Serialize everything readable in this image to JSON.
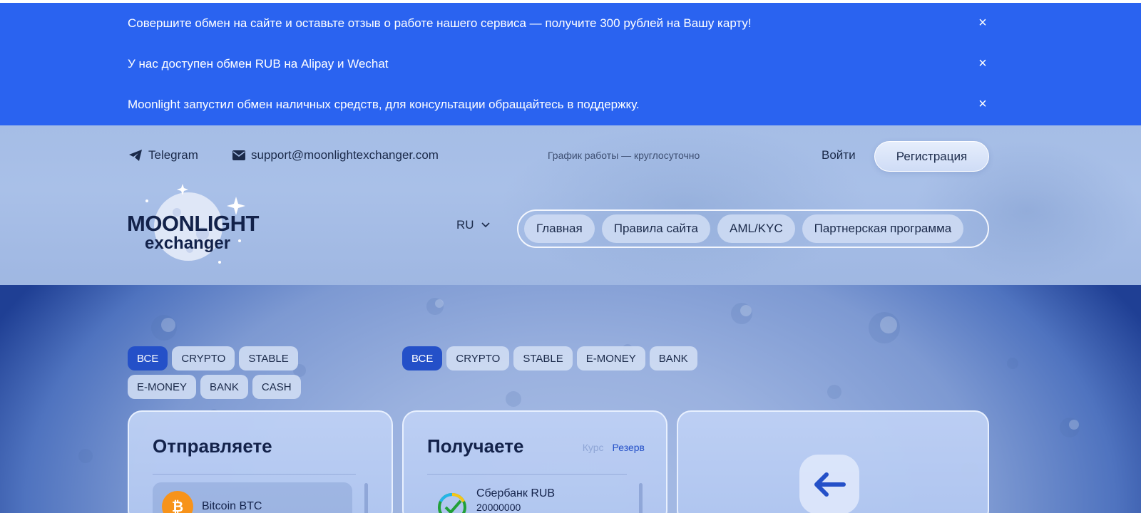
{
  "notices": [
    {
      "text": "Совершите обмен на сайте и оставьте отзыв о работе нашего сервиса — получите 300 рублей на Вашу карту!",
      "close": "×"
    },
    {
      "text": "У нас доступен обмен RUB на Alipay и Wechat",
      "close": "×"
    },
    {
      "text": "Moonlight запустил обмен наличных средств, для консультации обращайтесь в поддержку.",
      "close": "×"
    }
  ],
  "header": {
    "telegram": "Telegram",
    "email": "support@moonlightexchanger.com",
    "schedule": "График работы — круглосуточно",
    "login": "Войти",
    "register": "Регистрация"
  },
  "logo": {
    "line1": "MOONLIGHT",
    "line2": "exchanger"
  },
  "lang": {
    "current": "RU"
  },
  "nav": [
    "Главная",
    "Правила сайта",
    "AML/KYC",
    "Партнерская программа"
  ],
  "send_filters": [
    "ВСЕ",
    "CRYPTO",
    "STABLE",
    "E-MONEY",
    "BANK",
    "CASH"
  ],
  "receive_filters": [
    "ВСЕ",
    "CRYPTO",
    "STABLE",
    "E-MONEY",
    "BANK"
  ],
  "send": {
    "title": "Отправляете",
    "items": [
      {
        "name": "Bitcoin BTC",
        "icon": "bitcoin-icon"
      }
    ]
  },
  "receive": {
    "title": "Получаете",
    "tab_rate": "Курс",
    "tab_reserve": "Резерв",
    "items": [
      {
        "name": "Сбербанк RUB",
        "reserve": "20000000",
        "icon": "sberbank-icon"
      }
    ]
  },
  "colors": {
    "notice_bg": "#2a63f0",
    "accent": "#2450c8",
    "text": "#13224a"
  }
}
